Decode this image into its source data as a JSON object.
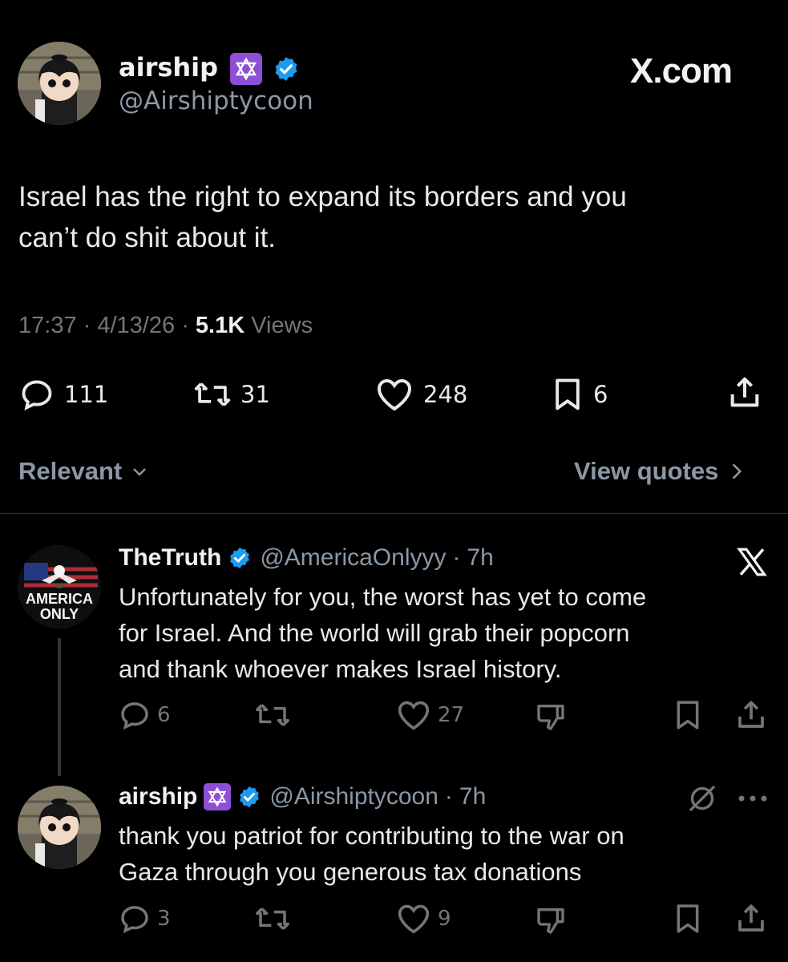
{
  "main_tweet": {
    "display_name": "airship",
    "handle": "@Airshiptycoon",
    "brand": "X.com",
    "text_line1": "Israel has the right to expand its borders and you",
    "text_line2": "can’t do shit about it.",
    "time": "17:37",
    "date": "4/13/26",
    "views_count": "5.1K",
    "views_label": "Views",
    "replies": "111",
    "reposts": "31",
    "likes": "248",
    "bookmarks": "6"
  },
  "sort": {
    "label": "Relevant",
    "view_quotes": "View quotes"
  },
  "reply1": {
    "display_name": "TheTruth",
    "handle": "@AmericaOnlyyy",
    "time": "7h",
    "avatar_text1": "AMERICA",
    "avatar_text2": "ONLY",
    "text_line1": "Unfortunately for you, the worst has yet to come",
    "text_line2": "for Israel. And the world will grab their popcorn",
    "text_line3": "and thank whoever makes Israel history.",
    "replies": "6",
    "likes": "27"
  },
  "reply2": {
    "display_name": "airship",
    "handle": "@Airshiptycoon",
    "time": "7h",
    "text_line1": "thank you patriot for contributing to the war on",
    "text_line2": "Gaza through you generous tax donations",
    "replies": "3",
    "likes": "9"
  },
  "colors": {
    "background": "#000000",
    "verified": "#1d9bf0",
    "muted": "#71767b",
    "emoji_purple": "#8e4fd6"
  },
  "icons": [
    "reply-icon",
    "repost-icon",
    "like-icon",
    "bookmark-icon",
    "share-icon",
    "dislike-icon",
    "chevron-down-icon",
    "chevron-right-icon",
    "x-logo-icon",
    "grok-icon",
    "more-icon",
    "verified-badge-icon",
    "star-of-david-icon"
  ]
}
